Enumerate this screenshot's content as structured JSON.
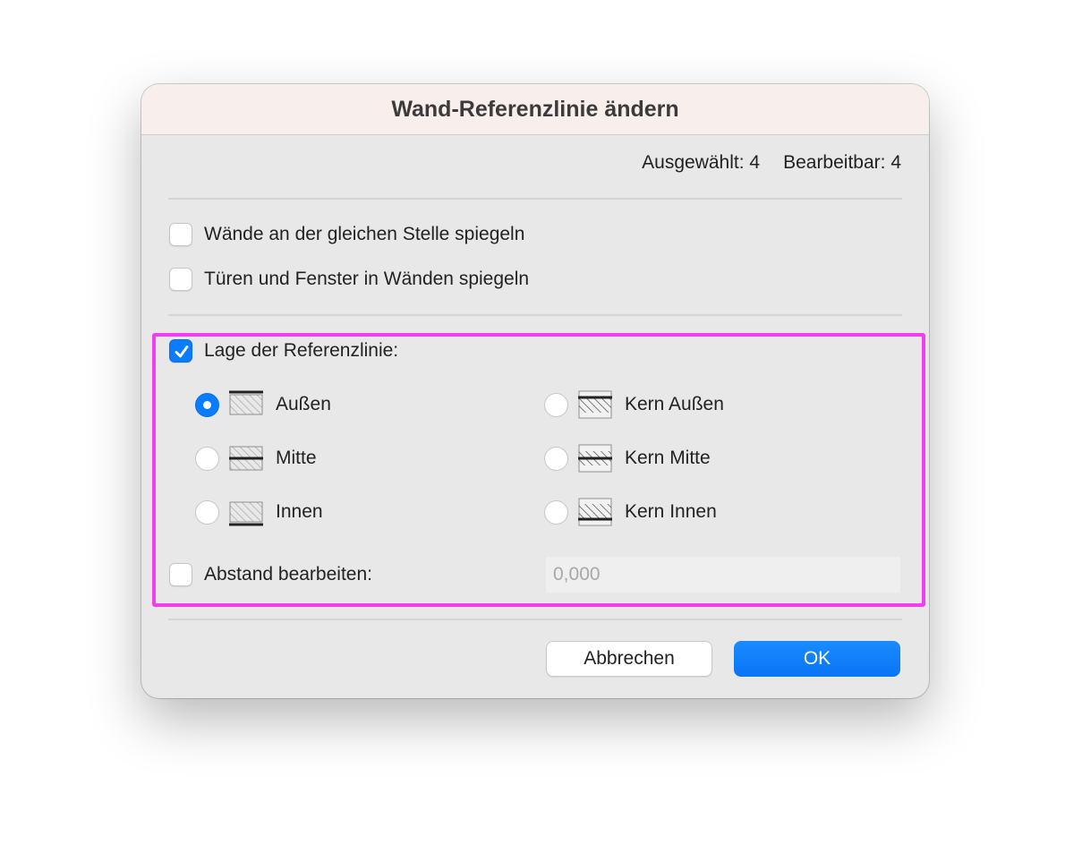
{
  "dialog": {
    "title": "Wand-Referenzlinie ändern",
    "selected_label": "Ausgewählt: 4",
    "editable_label": "Bearbeitbar: 4"
  },
  "options": {
    "mirror_walls": {
      "label": "Wände an der gleichen Stelle spiegeln",
      "checked": false
    },
    "mirror_openings": {
      "label": "Türen und Fenster in Wänden spiegeln",
      "checked": false
    }
  },
  "reference_line": {
    "label": "Lage der Referenzlinie:",
    "checked": true,
    "choices": [
      {
        "label": "Außen",
        "icon": "wall-outside-icon",
        "selected": true
      },
      {
        "label": "Mitte",
        "icon": "wall-center-icon",
        "selected": false
      },
      {
        "label": "Innen",
        "icon": "wall-inside-icon",
        "selected": false
      },
      {
        "label": "Kern Außen",
        "icon": "core-outside-icon",
        "selected": false
      },
      {
        "label": "Kern Mitte",
        "icon": "core-center-icon",
        "selected": false
      },
      {
        "label": "Kern Innen",
        "icon": "core-inside-icon",
        "selected": false
      }
    ]
  },
  "offset": {
    "label": "Abstand bearbeiten:",
    "checked": false,
    "placeholder": "0,000"
  },
  "buttons": {
    "cancel": "Abbrechen",
    "ok": "OK"
  },
  "colors": {
    "accent": "#0a7cff",
    "highlight": "#f23ef2"
  }
}
